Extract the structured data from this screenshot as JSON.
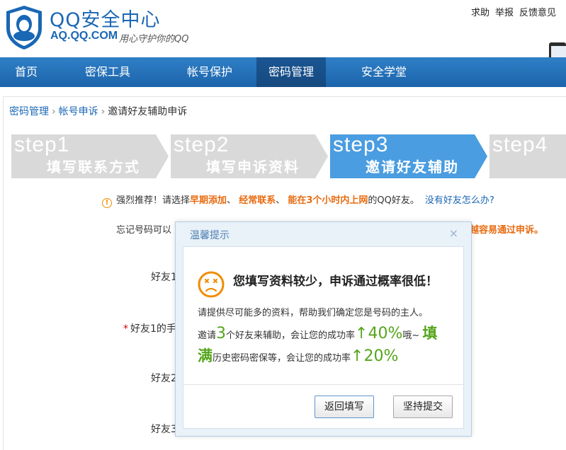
{
  "header": {
    "brand_title": "QQ安全中心",
    "brand_domain": "AQ.QQ.COM",
    "brand_slogan": "用心守护你的QQ",
    "top_links": [
      "求助",
      "举报",
      "反馈意见"
    ]
  },
  "nav": {
    "items": [
      "首页",
      "密保工具",
      "帐号保护",
      "密码管理",
      "安全学堂"
    ],
    "active": "密码管理"
  },
  "breadcrumb": {
    "items": [
      "密码管理",
      "帐号申诉",
      "邀请好友辅助申诉"
    ],
    "separator": "›"
  },
  "steps": [
    {
      "num": "step1",
      "label": "填写联系方式",
      "active": false
    },
    {
      "num": "step2",
      "label": "填写申诉资料",
      "active": false
    },
    {
      "num": "step3",
      "label": "邀请好友辅助",
      "active": true
    },
    {
      "num": "step4",
      "label": "",
      "active": false
    }
  ],
  "recommend": {
    "prefix": "强烈推荐！请选择",
    "opt1": "早期添加",
    "sep1": "、",
    "opt2": "经常联系",
    "sep2": "、",
    "opt3": "能在3个小时内上网",
    "suffix": "的QQ好友。",
    "help_link": "没有好友怎么办?"
  },
  "form": {
    "forget_prefix": "忘记号码可以",
    "forget_suffix": "越容易通过申诉。",
    "friend1": "好友1",
    "friend1_phone": "好友1的手",
    "friend2": "好友2",
    "friend3": "好友3"
  },
  "dialog": {
    "title": "温馨提示",
    "close": "×",
    "headline": "您填写资料较少，申诉通过概率很低！",
    "tip": "请提供尽可能多的资料，帮助我们确定您是号码的主人。",
    "r1_a": "邀请",
    "r1_num": "3",
    "r1_b": "个好友来辅助，会让您的成功率",
    "r1_rate": "↑40%",
    "r1_c": "哦~",
    "r1_fill": "填",
    "r2_fill": "满",
    "r2_b": "历史密码密保等，会让您的成功率",
    "r2_rate": "↑20%",
    "btn_back": "返回填写",
    "btn_submit": "坚持提交"
  },
  "colors": {
    "brand_blue": "#1a67b5",
    "orange": "#e86b10",
    "green": "#55a51c",
    "step_active": "#4a9de0",
    "step_inactive": "#d9d9d9"
  }
}
